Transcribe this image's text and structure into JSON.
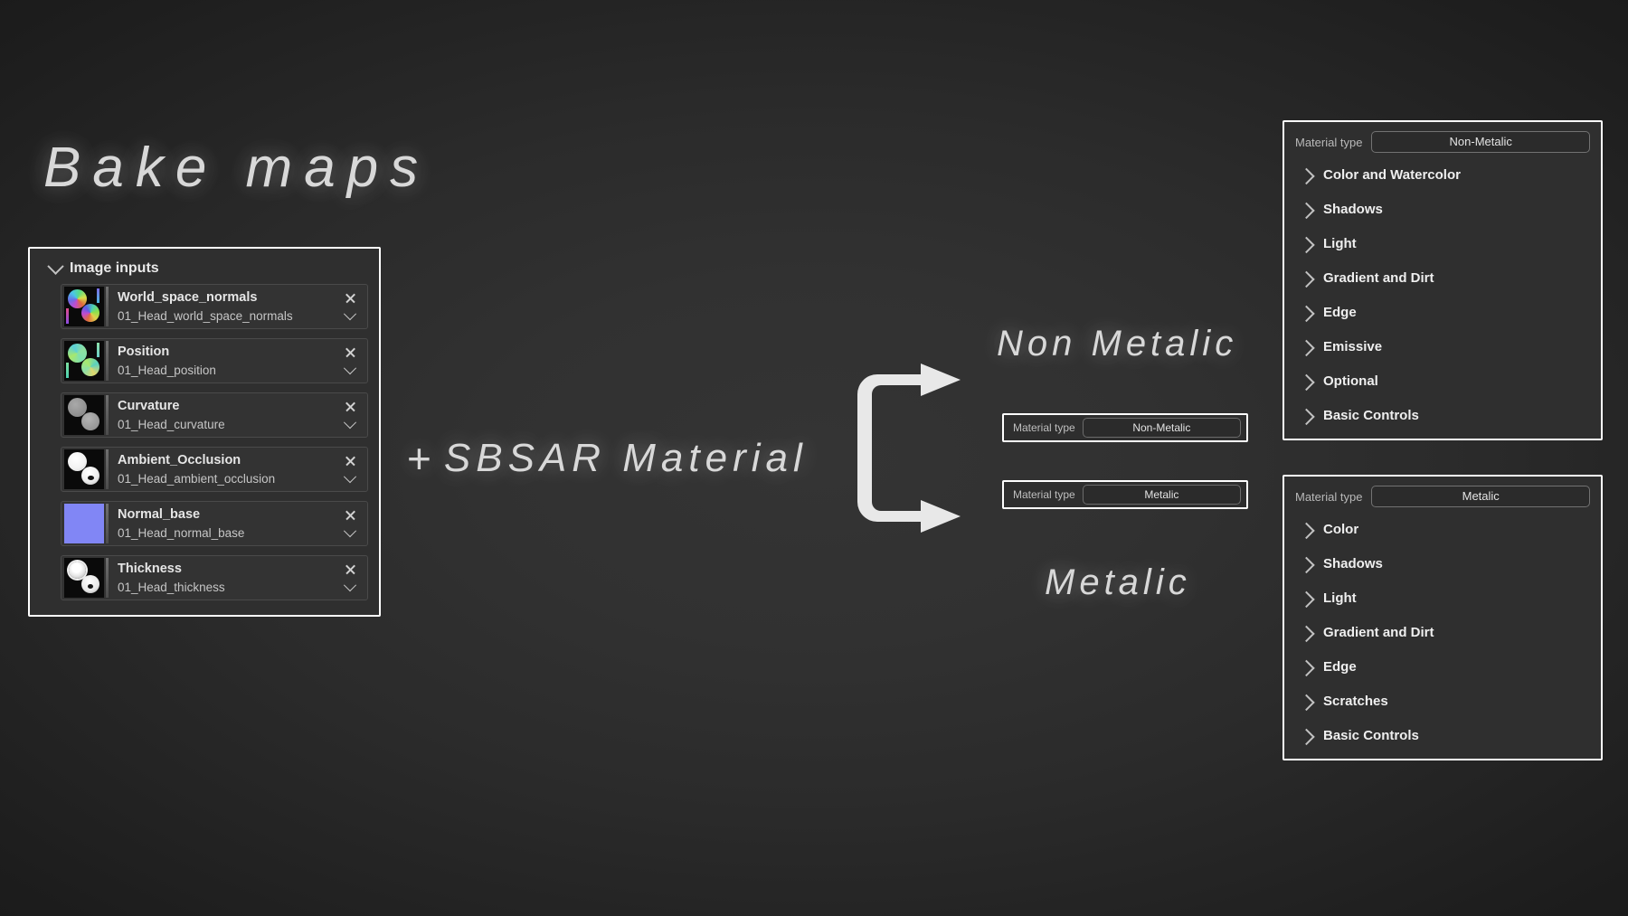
{
  "headings": {
    "bake_maps": "Bake maps",
    "sbsar_plus": "+",
    "sbsar_material": "SBSAR Material",
    "non_metalic": "Non Metalic",
    "metalic": "Metalic"
  },
  "image_inputs": {
    "title": "Image inputs",
    "collapse_icon": "chevron-down-icon",
    "rows": [
      {
        "name": "World_space_normals",
        "value": "01_Head_world_space_normals",
        "thumb": "world-space-normals-thumbnail",
        "remove_icon": "close-icon",
        "dropdown_icon": "chevron-down-icon"
      },
      {
        "name": "Position",
        "value": "01_Head_position",
        "thumb": "position-thumbnail",
        "remove_icon": "close-icon",
        "dropdown_icon": "chevron-down-icon"
      },
      {
        "name": "Curvature",
        "value": "01_Head_curvature",
        "thumb": "curvature-thumbnail",
        "remove_icon": "close-icon",
        "dropdown_icon": "chevron-down-icon"
      },
      {
        "name": "Ambient_Occlusion",
        "value": "01_Head_ambient_occlusion",
        "thumb": "ambient-occlusion-thumbnail",
        "remove_icon": "close-icon",
        "dropdown_icon": "chevron-down-icon"
      },
      {
        "name": "Normal_base",
        "value": "01_Head_normal_base",
        "thumb": "normal-base-thumbnail",
        "remove_icon": "close-icon",
        "dropdown_icon": "chevron-down-icon"
      },
      {
        "name": "Thickness",
        "value": "01_Head_thickness",
        "thumb": "thickness-thumbnail",
        "remove_icon": "close-icon",
        "dropdown_icon": "chevron-down-icon"
      }
    ]
  },
  "mini_widgets": [
    {
      "label": "Material type",
      "value": "Non-Metalic"
    },
    {
      "label": "Material type",
      "value": "Metalic"
    }
  ],
  "panels": {
    "non_metalic": {
      "material_type_label": "Material type",
      "material_type_value": "Non-Metalic",
      "items": [
        "Color and Watercolor",
        "Shadows",
        "Light",
        "Gradient and Dirt",
        "Edge",
        "Emissive",
        "Optional",
        "Basic Controls"
      ]
    },
    "metalic": {
      "material_type_label": "Material type",
      "material_type_value": "Metalic",
      "items": [
        "Color",
        "Shadows",
        "Light",
        "Gradient and Dirt",
        "Edge",
        "Scratches",
        "Basic Controls"
      ]
    }
  },
  "arrow": {
    "name": "branching-arrow",
    "color": "#e8e8e8"
  },
  "colors": {
    "background_center": "#313131",
    "background_edge": "#1b1b1b",
    "panel_background": "#2f2f2f",
    "panel_border": "#ffffff",
    "text_primary": "#e9e9e9",
    "text_secondary": "#c0c0c0",
    "normal_base_swatch": "#8186f5"
  }
}
